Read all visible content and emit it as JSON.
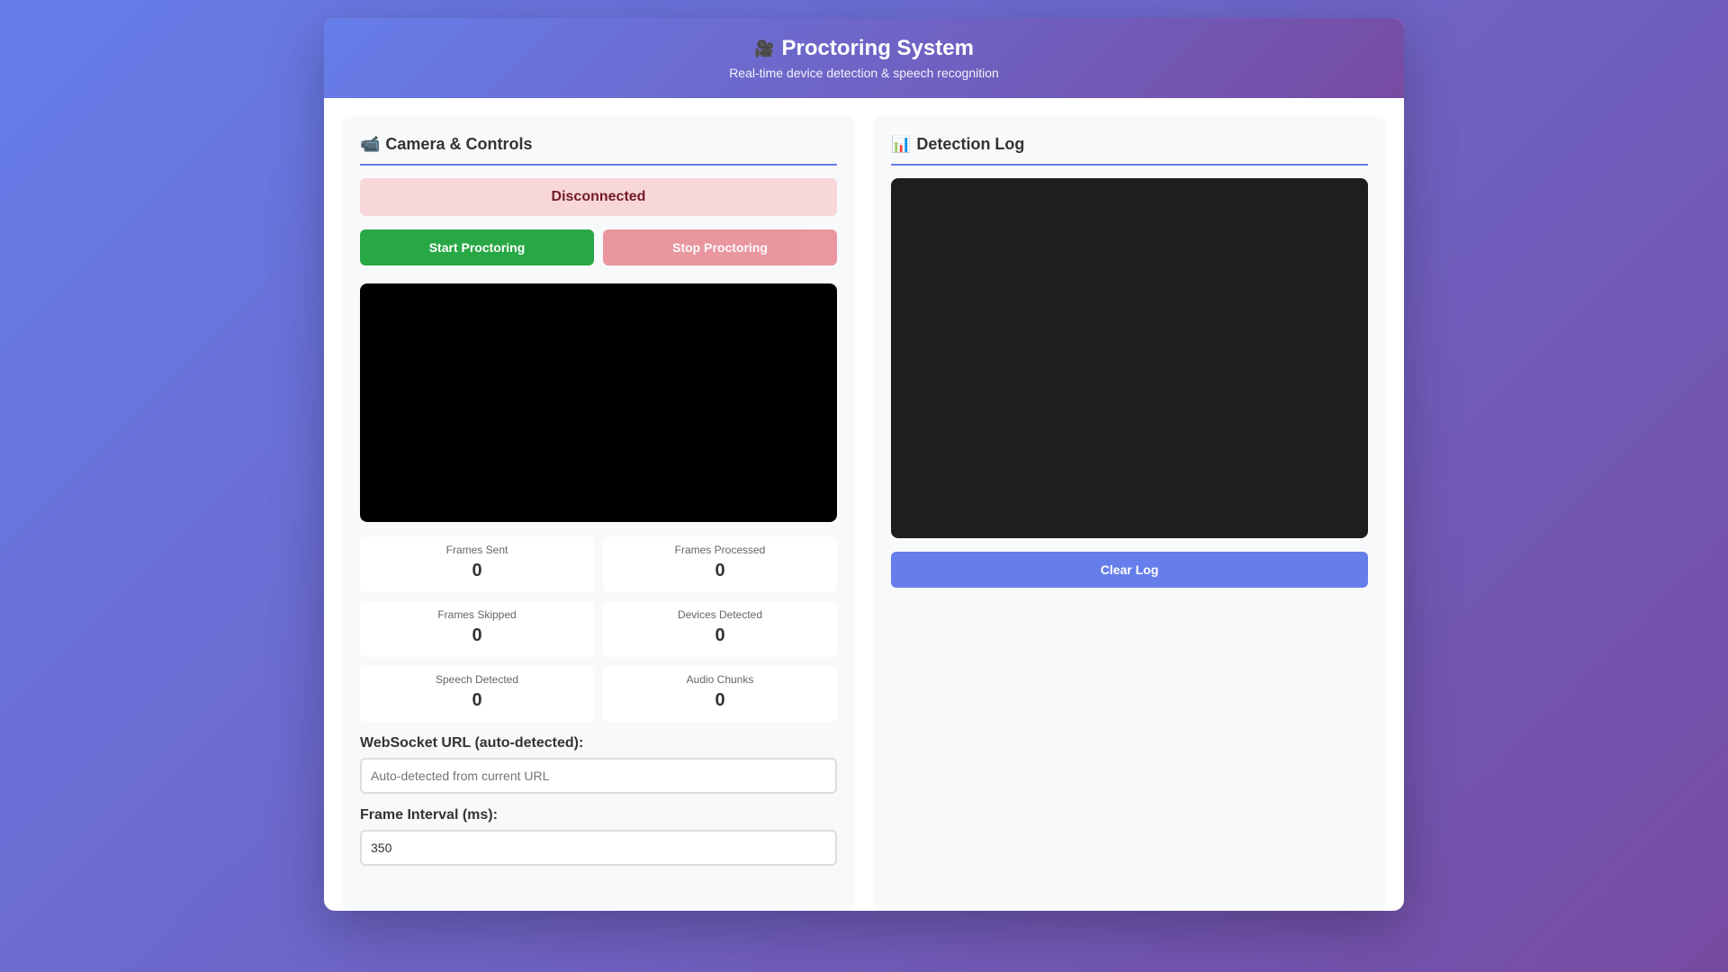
{
  "header": {
    "icon": "video-camera-icon",
    "icon_glyph": "🎥",
    "title": "Proctoring System",
    "subtitle": "Real-time device detection & speech recognition"
  },
  "camera_panel": {
    "icon": "camcorder-icon",
    "icon_glyph": "📹",
    "title": "Camera & Controls",
    "status": "Disconnected",
    "start_label": "Start Proctoring",
    "stop_label": "Stop Proctoring",
    "stats": {
      "frames_sent": {
        "label": "Frames Sent",
        "value": "0"
      },
      "frames_processed": {
        "label": "Frames Processed",
        "value": "0"
      },
      "frames_skipped": {
        "label": "Frames Skipped",
        "value": "0"
      },
      "devices_detected": {
        "label": "Devices Detected",
        "value": "0"
      },
      "speech_detected": {
        "label": "Speech Detected",
        "value": "0"
      },
      "audio_chunks": {
        "label": "Audio Chunks",
        "value": "0"
      }
    },
    "ws_label": "WebSocket URL (auto-detected):",
    "ws_value": "",
    "ws_placeholder": "Auto-detected from current URL",
    "interval_label": "Frame Interval (ms):",
    "interval_value": "350"
  },
  "log_panel": {
    "icon": "bar-chart-icon",
    "icon_glyph": "📊",
    "title": "Detection Log",
    "clear_label": "Clear Log"
  },
  "colors": {
    "gradient_start": "#667eea",
    "gradient_end": "#764ba2",
    "start_button": "#28a745",
    "stop_button": "#dc3545",
    "status_bg": "#f8d7da",
    "status_text": "#721c24"
  }
}
